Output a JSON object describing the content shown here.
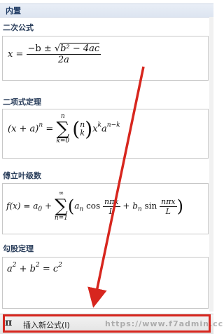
{
  "header": {
    "title": "内置"
  },
  "sections": [
    {
      "title": "二次公式"
    },
    {
      "title": "二项式定理"
    },
    {
      "title": "傅立叶级数"
    },
    {
      "title": "勾股定理"
    }
  ],
  "formulas": {
    "quadratic": {
      "lhs": "x =",
      "numerator_pre": "−b ± ",
      "sqrt_body": "b² − 4ac",
      "denominator": "2a"
    },
    "binomial": {
      "lhs": "(x + a)",
      "lhs_exp": "n",
      "eq": " = ",
      "sum_top": "n",
      "sum_bottom": "k=0",
      "binom_top": "n",
      "binom_bottom": "k",
      "term_x": "x",
      "term_x_exp": "k",
      "term_a": "a",
      "term_a_exp": "n−k"
    },
    "fourier": {
      "lhs": "f(x) = a",
      "lhs_sub": "0",
      "plus": " + ",
      "sum_top": "∞",
      "sum_bottom": "n=1",
      "a_term": "a",
      "a_sub": "n",
      "cos": " cos ",
      "frac1_num": "nπx",
      "frac1_den": "L",
      "b_plus": " + b",
      "b_sub": "n",
      "sin": " sin ",
      "frac2_num": "nπx",
      "frac2_den": "L"
    },
    "pythagoras": {
      "a": "a",
      "a_exp": "2",
      "plus": " + b",
      "b_exp": "2",
      "eq": " = c",
      "c_exp": "2"
    }
  },
  "footer": {
    "icon": "pi-icon",
    "insert_label": "插入新公式(I)",
    "watermark": "https://www.f7admin.cc"
  },
  "colors": {
    "highlight": "#d7261e",
    "arrow": "#d7261e"
  }
}
